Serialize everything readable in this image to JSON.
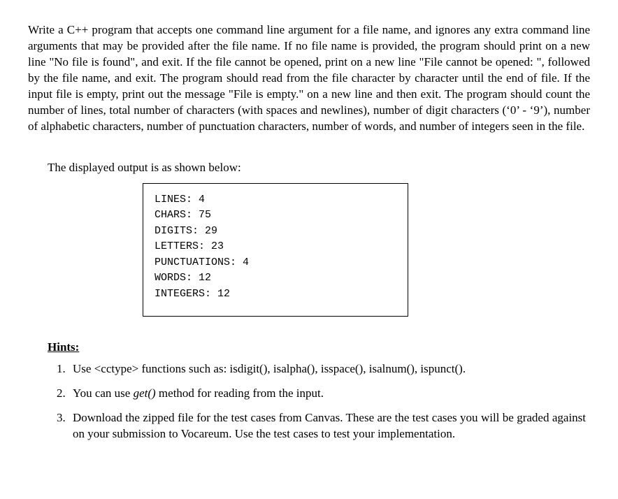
{
  "main_paragraph": "Write a C++ program that accepts one command line argument for a file name, and ignores any extra command line arguments that may be provided after the file name. If no file name is provided, the program should print on a new line \"No file is found\", and exit. If the file cannot be opened, print on a new line \"File cannot be opened: \", followed by the file name, and exit. The program should read from the file character by character until the end of file. If the input file is empty, print out the message \"File is empty.\" on a new line and then exit. The program should count the number of lines, total number of characters (with spaces and newlines), number of digit characters (‘0’ - ‘9’), number of alphabetic characters, number of punctuation characters, number of words, and number of integers seen in the file.",
  "output_intro": "The displayed output is as shown below:",
  "output_lines": {
    "l1": "LINES: 4",
    "l2": "CHARS: 75",
    "l3": "DIGITS: 29",
    "l4": "LETTERS: 23",
    "l5": "PUNCTUATIONS: 4",
    "l6": "WORDS: 12",
    "l7": "INTEGERS: 12"
  },
  "hints_heading": "Hints:",
  "hints": {
    "h1": "Use <cctype> functions such as: isdigit(), isalpha(), isspace(), isalnum(), ispunct().",
    "h2_pre": "You can use ",
    "h2_em": "get()",
    "h2_post": " method for reading from the input.",
    "h3": "Download the zipped file for the test cases from Canvas. These are the test cases you will be graded against on your submission to Vocareum. Use the test cases to test your implementation."
  }
}
